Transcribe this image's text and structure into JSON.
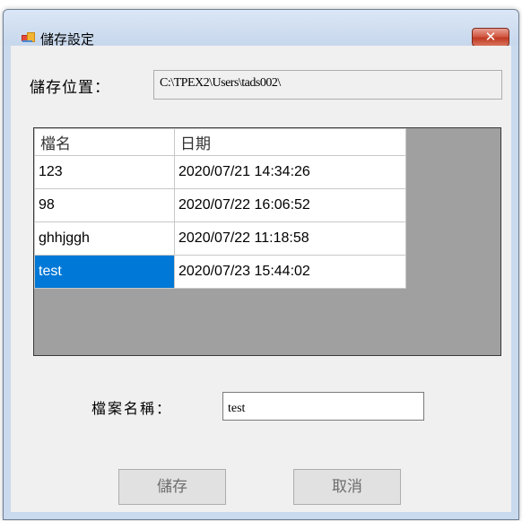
{
  "window": {
    "title": "儲存設定",
    "close_glyph": "✕",
    "accent_color": "#0078d7"
  },
  "location": {
    "label": "儲存位置：",
    "value": "C:\\TPEX2\\Users\\tads002\\"
  },
  "grid": {
    "columns": [
      "檔名",
      "日期"
    ],
    "rows": [
      {
        "name": "123",
        "date": "2020/07/21 14:34:26"
      },
      {
        "name": "98",
        "date": "2020/07/22 16:06:52"
      },
      {
        "name": "ghhjggh",
        "date": "2020/07/22 11:18:58"
      },
      {
        "name": "test",
        "date": "2020/07/23 15:44:02",
        "selected": true
      }
    ]
  },
  "filename": {
    "label": "檔案名稱：",
    "value": "test"
  },
  "buttons": {
    "save_label": "儲存",
    "cancel_label": "取消"
  }
}
